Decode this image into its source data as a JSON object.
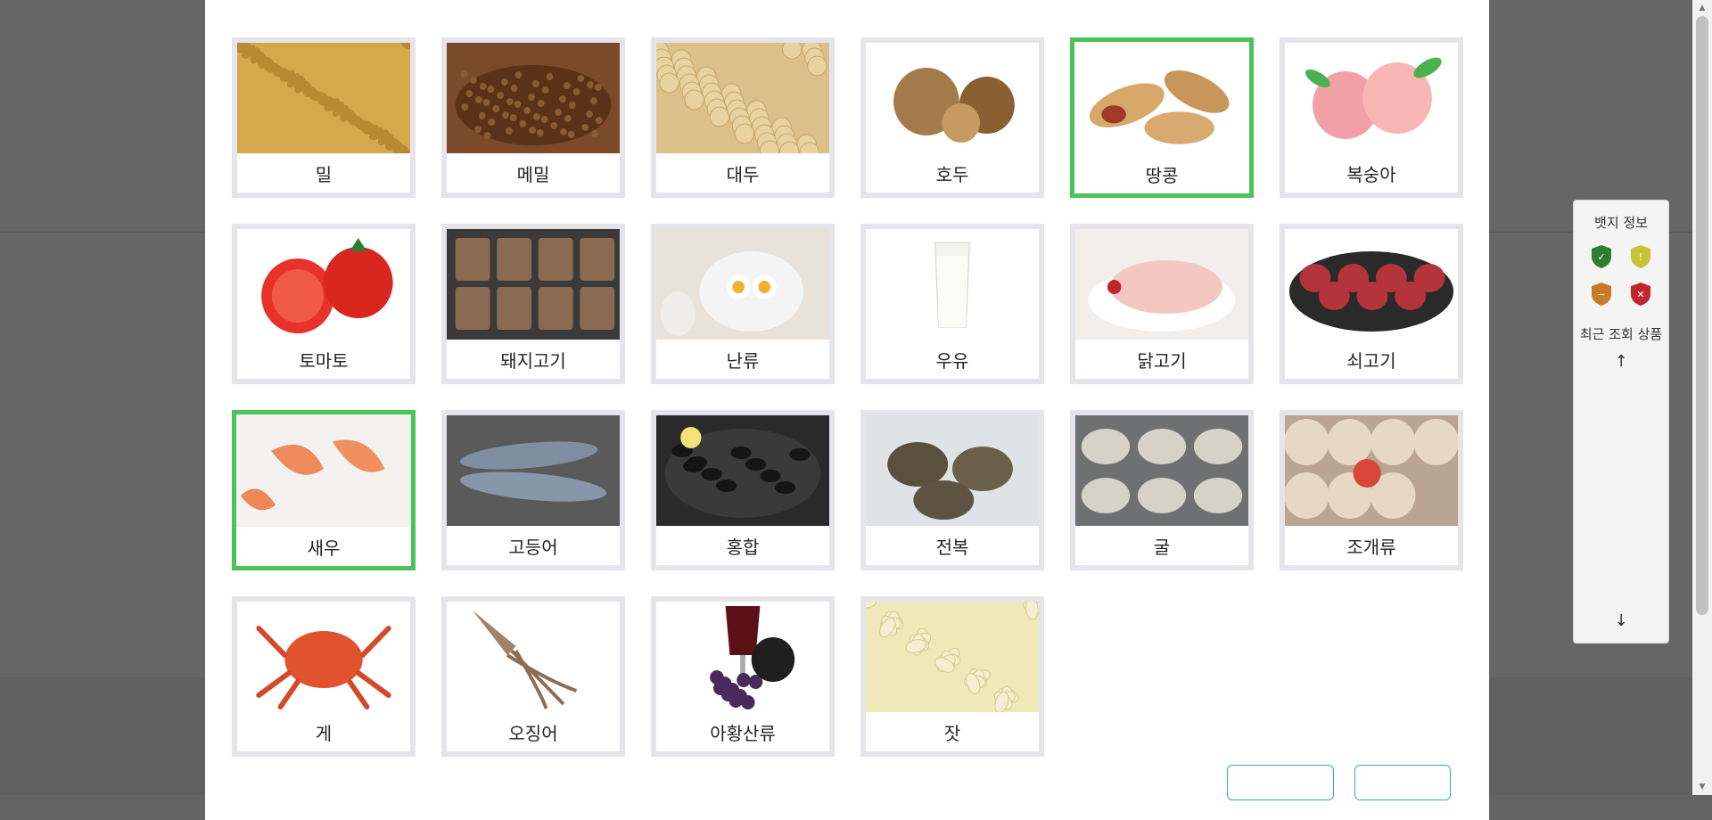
{
  "modal": {
    "title": "",
    "items": [
      {
        "label": "밀",
        "selected": false
      },
      {
        "label": "메밀",
        "selected": false
      },
      {
        "label": "대두",
        "selected": false
      },
      {
        "label": "호두",
        "selected": false
      },
      {
        "label": "땅콩",
        "selected": true
      },
      {
        "label": "복숭아",
        "selected": false
      },
      {
        "label": "토마토",
        "selected": false
      },
      {
        "label": "돼지고기",
        "selected": false
      },
      {
        "label": "난류",
        "selected": false
      },
      {
        "label": "우유",
        "selected": false
      },
      {
        "label": "닭고기",
        "selected": false
      },
      {
        "label": "쇠고기",
        "selected": false
      },
      {
        "label": "새우",
        "selected": true
      },
      {
        "label": "고등어",
        "selected": false
      },
      {
        "label": "홍합",
        "selected": false
      },
      {
        "label": "전복",
        "selected": false
      },
      {
        "label": "굴",
        "selected": false
      },
      {
        "label": "조개류",
        "selected": false
      },
      {
        "label": "게",
        "selected": false
      },
      {
        "label": "오징어",
        "selected": false
      },
      {
        "label": "아황산류",
        "selected": false
      },
      {
        "label": "잣",
        "selected": false
      }
    ]
  },
  "side_widget": {
    "badge_title": "뱃지 정보",
    "recent_title": "최근 조회 상품",
    "badges": [
      {
        "name": "green-shield-icon",
        "color": "#2f7d32",
        "symbol": "✓"
      },
      {
        "name": "yellow-shield-icon",
        "color": "#c8c43a",
        "symbol": "!"
      },
      {
        "name": "orange-shield-icon",
        "color": "#c77a2a",
        "symbol": "−"
      },
      {
        "name": "red-shield-icon",
        "color": "#c0262d",
        "symbol": "✕"
      }
    ],
    "up_arrow": "↑",
    "down_arrow": "↓"
  },
  "colors": {
    "selected_border": "#4cc35a",
    "card_border": "#e4e4ea",
    "button_border": "#3aa3d6"
  }
}
